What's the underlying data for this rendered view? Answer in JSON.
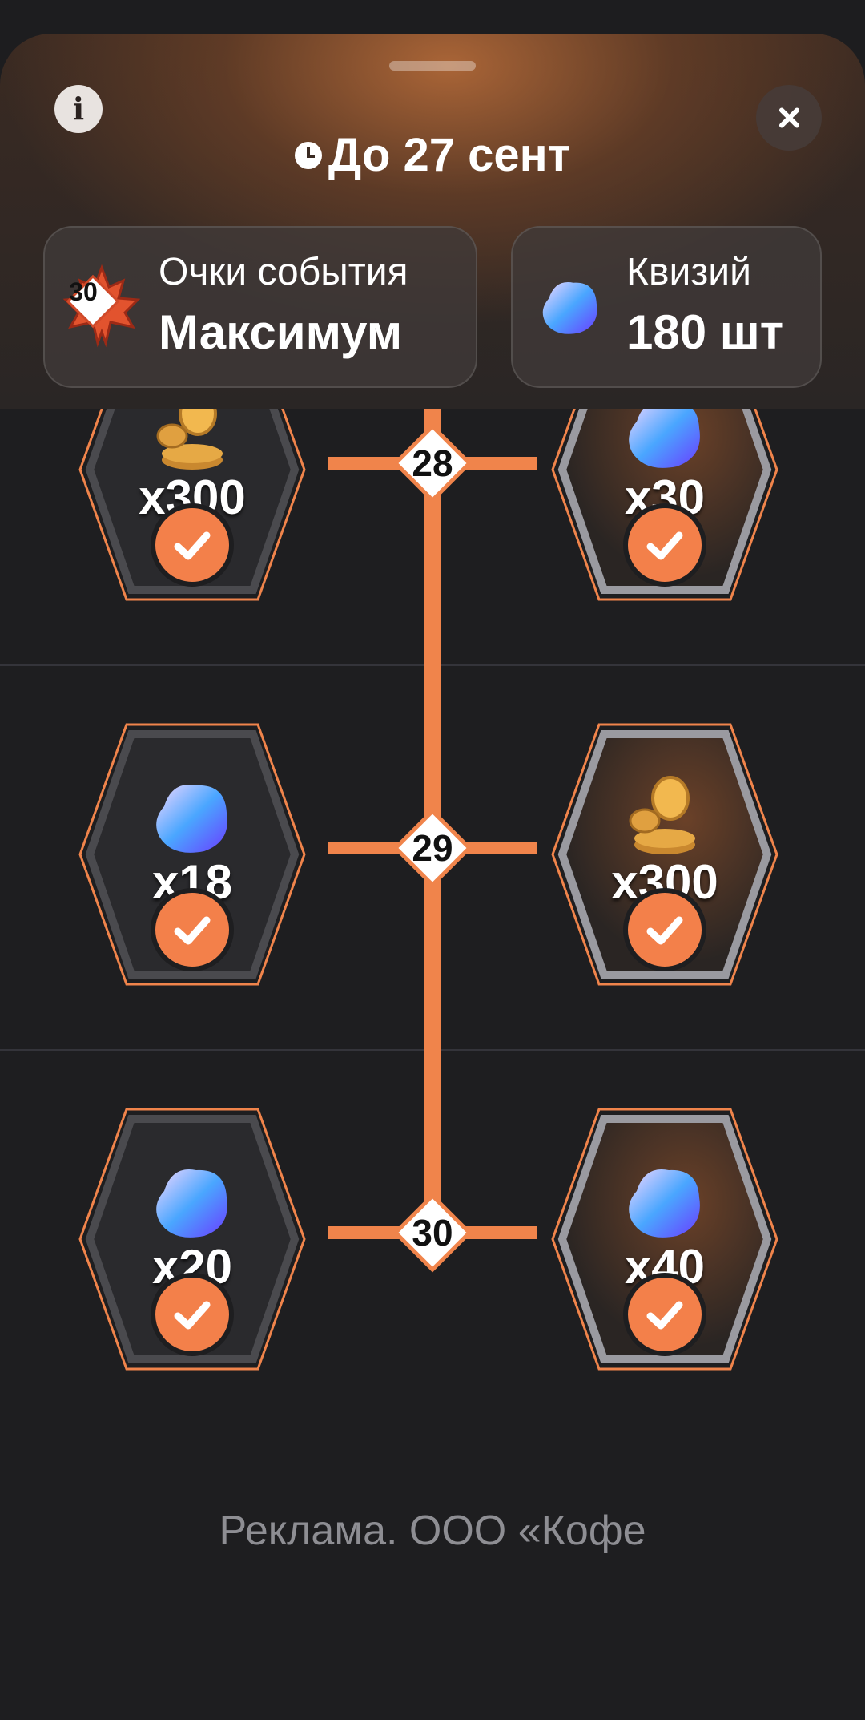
{
  "header": {
    "info_label": "i",
    "deadline": "До 27 сент",
    "event_points": {
      "label": "Очки события",
      "value": "Максимум",
      "badge": "30"
    },
    "currency": {
      "label": "Квизий",
      "value": "180 шт"
    }
  },
  "levels": [
    {
      "level": "28",
      "left": {
        "reward": "coins",
        "amount": "x300",
        "claimed": true
      },
      "right": {
        "reward": "gem",
        "amount": "x30",
        "claimed": true
      }
    },
    {
      "level": "29",
      "left": {
        "reward": "gem",
        "amount": "x18",
        "claimed": true
      },
      "right": {
        "reward": "coins",
        "amount": "x300",
        "claimed": true
      }
    },
    {
      "level": "30",
      "left": {
        "reward": "gem",
        "amount": "x20",
        "claimed": true
      },
      "right": {
        "reward": "gem",
        "amount": "x40",
        "claimed": true
      }
    }
  ],
  "footer": {
    "ad_text": "Реклама. ООО «Кофе"
  },
  "colors": {
    "accent": "#f0844b",
    "background": "#1e1e20",
    "check": "#f3804a"
  },
  "icons": [
    "info-icon",
    "close-icon",
    "clock-icon",
    "maple-leaf-icon",
    "gem-icon",
    "coins-icon",
    "check-icon"
  ]
}
